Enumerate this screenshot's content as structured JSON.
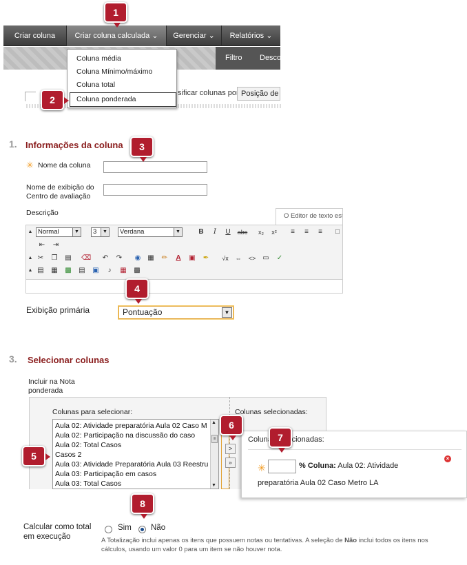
{
  "toolbar": {
    "buttons": [
      "Criar coluna",
      "Criar coluna calculada",
      "Gerenciar",
      "Relatórios"
    ],
    "sub_buttons": [
      "Filtro",
      "Desco"
    ],
    "dropdown": [
      "Coluna média",
      "Coluna Mínimo/máximo",
      "Coluna total",
      "Coluna ponderada"
    ],
    "sort_label": "sificar colunas por:",
    "sort_value": "Posição de la"
  },
  "badges": [
    "1",
    "2",
    "3",
    "4",
    "5",
    "6",
    "7",
    "8"
  ],
  "section1": {
    "number": "1.",
    "title": "Informações da coluna",
    "name_label": "Nome da coluna",
    "display_label_1": "Nome de exibição do",
    "display_label_2": "Centro de avaliação",
    "description_label": "Descrição",
    "editor_tab": "O Editor de texto está",
    "editor": {
      "format": "Normal",
      "size": "3",
      "font": "Verdana"
    },
    "primary_display_label": "Exibição primária",
    "primary_display_value": "Pontuação"
  },
  "section3": {
    "number": "3.",
    "title": "Selecionar colunas",
    "include_label_1": "Incluir na Nota",
    "include_label_2": "ponderada",
    "available_header": "Colunas para selecionar:",
    "selected_header": "Colunas selecionadas:",
    "available_items": [
      "Aula 02: Atividade preparatória Aula 02 Caso M",
      "Aula 02: Participação na discussão do caso",
      "Aula 02: Total Casos",
      "Casos 2",
      "Aula 03: Atividade Preparatória Aula 03 Reestru",
      "Aula 03: Participação em casos",
      "Aula 03: Total Casos"
    ],
    "popup_header": "Colunas selecionadas:",
    "popup_pct": "% Coluna:",
    "popup_value_1": "Aula 02: Atividade",
    "popup_value_2": "preparatória Aula 02 Caso Metro LA"
  },
  "running_total": {
    "label_1": "Calcular como total",
    "label_2": "em execução",
    "yes": "Sim",
    "no": "Não",
    "help_1": "A Totalização inclui apenas os itens que possuem notas ou tentativas. A seleção de",
    "help_bold": "Não",
    "help_2": "inclui todos os itens nos cálculos, usando um valor 0 para um item se não houver nota."
  },
  "colors": {
    "accent": "#b11d2e",
    "heading": "#8a1d1d",
    "required": "#f29a1f"
  }
}
